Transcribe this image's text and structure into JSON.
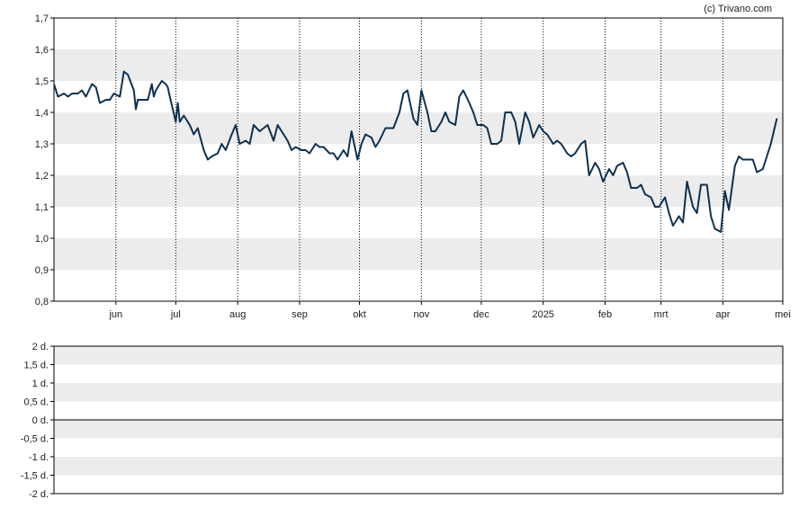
{
  "copyright": "(c) Trivano.com",
  "colors": {
    "line": "#0d3150",
    "band": "#ececec",
    "axis": "#000000",
    "grid_dotted": "#000000"
  },
  "chart_data": [
    {
      "type": "line",
      "title": "",
      "xlabel": "",
      "ylabel": "",
      "ylim": [
        0.8,
        1.7
      ],
      "y_ticks": [
        "1,7",
        "1,6",
        "1,5",
        "1,4",
        "1,3",
        "1,2",
        "1,1",
        "1,0",
        "0,9",
        "0,8"
      ],
      "y_tick_values": [
        1.7,
        1.6,
        1.5,
        1.4,
        1.3,
        1.2,
        1.1,
        1.0,
        0.9,
        0.8
      ],
      "x_range": [
        "2024-05-01",
        "2025-05-01"
      ],
      "x_ticks": [
        {
          "label": "jun",
          "date": "2024-06-01"
        },
        {
          "label": "jul",
          "date": "2024-07-01"
        },
        {
          "label": "aug",
          "date": "2024-08-01"
        },
        {
          "label": "sep",
          "date": "2024-09-01"
        },
        {
          "label": "okt",
          "date": "2024-10-01"
        },
        {
          "label": "nov",
          "date": "2024-11-01"
        },
        {
          "label": "dec",
          "date": "2024-12-01"
        },
        {
          "label": "2025",
          "date": "2025-01-01"
        },
        {
          "label": "feb",
          "date": "2025-02-01"
        },
        {
          "label": "mrt",
          "date": "2025-03-01"
        },
        {
          "label": "apr",
          "date": "2025-04-01"
        },
        {
          "label": "mei",
          "date": "2025-05-01"
        }
      ],
      "grid": "alternating horizontal bands, dotted vertical month lines",
      "series": [
        {
          "points": [
            [
              "2024-05-01",
              1.49
            ],
            [
              "2024-05-03",
              1.45
            ],
            [
              "2024-05-06",
              1.46
            ],
            [
              "2024-05-08",
              1.45
            ],
            [
              "2024-05-10",
              1.46
            ],
            [
              "2024-05-13",
              1.46
            ],
            [
              "2024-05-15",
              1.47
            ],
            [
              "2024-05-17",
              1.45
            ],
            [
              "2024-05-20",
              1.49
            ],
            [
              "2024-05-22",
              1.48
            ],
            [
              "2024-05-24",
              1.43
            ],
            [
              "2024-05-27",
              1.44
            ],
            [
              "2024-05-29",
              1.44
            ],
            [
              "2024-05-31",
              1.46
            ],
            [
              "2024-06-03",
              1.45
            ],
            [
              "2024-06-05",
              1.53
            ],
            [
              "2024-06-07",
              1.52
            ],
            [
              "2024-06-10",
              1.47
            ],
            [
              "2024-06-11",
              1.41
            ],
            [
              "2024-06-12",
              1.44
            ],
            [
              "2024-06-14",
              1.44
            ],
            [
              "2024-06-17",
              1.44
            ],
            [
              "2024-06-19",
              1.49
            ],
            [
              "2024-06-20",
              1.45
            ],
            [
              "2024-06-21",
              1.47
            ],
            [
              "2024-06-24",
              1.5
            ],
            [
              "2024-06-26",
              1.49
            ],
            [
              "2024-06-27",
              1.48
            ],
            [
              "2024-06-28",
              1.45
            ],
            [
              "2024-07-01",
              1.37
            ],
            [
              "2024-07-02",
              1.43
            ],
            [
              "2024-07-03",
              1.37
            ],
            [
              "2024-07-05",
              1.39
            ],
            [
              "2024-07-08",
              1.36
            ],
            [
              "2024-07-10",
              1.33
            ],
            [
              "2024-07-12",
              1.35
            ],
            [
              "2024-07-15",
              1.28
            ],
            [
              "2024-07-17",
              1.25
            ],
            [
              "2024-07-19",
              1.26
            ],
            [
              "2024-07-22",
              1.27
            ],
            [
              "2024-07-24",
              1.3
            ],
            [
              "2024-07-26",
              1.28
            ],
            [
              "2024-07-29",
              1.33
            ],
            [
              "2024-07-31",
              1.36
            ],
            [
              "2024-08-02",
              1.3
            ],
            [
              "2024-08-05",
              1.31
            ],
            [
              "2024-08-07",
              1.3
            ],
            [
              "2024-08-09",
              1.36
            ],
            [
              "2024-08-12",
              1.34
            ],
            [
              "2024-08-14",
              1.35
            ],
            [
              "2024-08-16",
              1.36
            ],
            [
              "2024-08-19",
              1.31
            ],
            [
              "2024-08-21",
              1.36
            ],
            [
              "2024-08-23",
              1.34
            ],
            [
              "2024-08-26",
              1.31
            ],
            [
              "2024-08-28",
              1.28
            ],
            [
              "2024-08-30",
              1.29
            ],
            [
              "2024-09-02",
              1.28
            ],
            [
              "2024-09-04",
              1.28
            ],
            [
              "2024-09-06",
              1.27
            ],
            [
              "2024-09-09",
              1.3
            ],
            [
              "2024-09-11",
              1.29
            ],
            [
              "2024-09-13",
              1.29
            ],
            [
              "2024-09-16",
              1.27
            ],
            [
              "2024-09-18",
              1.27
            ],
            [
              "2024-09-20",
              1.25
            ],
            [
              "2024-09-23",
              1.28
            ],
            [
              "2024-09-25",
              1.26
            ],
            [
              "2024-09-27",
              1.34
            ],
            [
              "2024-09-30",
              1.25
            ],
            [
              "2024-10-02",
              1.3
            ],
            [
              "2024-10-04",
              1.33
            ],
            [
              "2024-10-07",
              1.32
            ],
            [
              "2024-10-09",
              1.29
            ],
            [
              "2024-10-11",
              1.31
            ],
            [
              "2024-10-14",
              1.35
            ],
            [
              "2024-10-16",
              1.35
            ],
            [
              "2024-10-18",
              1.35
            ],
            [
              "2024-10-21",
              1.4
            ],
            [
              "2024-10-23",
              1.46
            ],
            [
              "2024-10-25",
              1.47
            ],
            [
              "2024-10-28",
              1.38
            ],
            [
              "2024-10-30",
              1.36
            ],
            [
              "2024-11-01",
              1.47
            ],
            [
              "2024-11-04",
              1.4
            ],
            [
              "2024-11-06",
              1.34
            ],
            [
              "2024-11-08",
              1.34
            ],
            [
              "2024-11-11",
              1.37
            ],
            [
              "2024-11-13",
              1.4
            ],
            [
              "2024-11-15",
              1.37
            ],
            [
              "2024-11-18",
              1.36
            ],
            [
              "2024-11-20",
              1.45
            ],
            [
              "2024-11-22",
              1.47
            ],
            [
              "2024-11-25",
              1.43
            ],
            [
              "2024-11-27",
              1.4
            ],
            [
              "2024-11-29",
              1.36
            ],
            [
              "2024-12-02",
              1.36
            ],
            [
              "2024-12-04",
              1.35
            ],
            [
              "2024-12-06",
              1.3
            ],
            [
              "2024-12-09",
              1.3
            ],
            [
              "2024-12-11",
              1.31
            ],
            [
              "2024-12-13",
              1.4
            ],
            [
              "2024-12-16",
              1.4
            ],
            [
              "2024-12-18",
              1.37
            ],
            [
              "2024-12-20",
              1.3
            ],
            [
              "2024-12-23",
              1.4
            ],
            [
              "2024-12-25",
              1.37
            ],
            [
              "2024-12-27",
              1.32
            ],
            [
              "2024-12-30",
              1.36
            ],
            [
              "2025-01-01",
              1.34
            ],
            [
              "2025-01-03",
              1.33
            ],
            [
              "2025-01-06",
              1.3
            ],
            [
              "2025-01-08",
              1.31
            ],
            [
              "2025-01-10",
              1.3
            ],
            [
              "2025-01-13",
              1.27
            ],
            [
              "2025-01-15",
              1.26
            ],
            [
              "2025-01-17",
              1.27
            ],
            [
              "2025-01-20",
              1.3
            ],
            [
              "2025-01-22",
              1.31
            ],
            [
              "2025-01-24",
              1.2
            ],
            [
              "2025-01-27",
              1.24
            ],
            [
              "2025-01-29",
              1.22
            ],
            [
              "2025-01-31",
              1.18
            ],
            [
              "2025-02-03",
              1.22
            ],
            [
              "2025-02-05",
              1.2
            ],
            [
              "2025-02-07",
              1.23
            ],
            [
              "2025-02-10",
              1.24
            ],
            [
              "2025-02-12",
              1.21
            ],
            [
              "2025-02-14",
              1.16
            ],
            [
              "2025-02-17",
              1.16
            ],
            [
              "2025-02-19",
              1.17
            ],
            [
              "2025-02-21",
              1.14
            ],
            [
              "2025-02-24",
              1.13
            ],
            [
              "2025-02-26",
              1.1
            ],
            [
              "2025-02-28",
              1.1
            ],
            [
              "2025-03-03",
              1.13
            ],
            [
              "2025-03-05",
              1.08
            ],
            [
              "2025-03-07",
              1.04
            ],
            [
              "2025-03-10",
              1.07
            ],
            [
              "2025-03-12",
              1.05
            ],
            [
              "2025-03-14",
              1.18
            ],
            [
              "2025-03-17",
              1.1
            ],
            [
              "2025-03-19",
              1.08
            ],
            [
              "2025-03-21",
              1.17
            ],
            [
              "2025-03-24",
              1.17
            ],
            [
              "2025-03-26",
              1.07
            ],
            [
              "2025-03-28",
              1.03
            ],
            [
              "2025-03-31",
              1.02
            ],
            [
              "2025-04-02",
              1.15
            ],
            [
              "2025-04-04",
              1.09
            ],
            [
              "2025-04-07",
              1.23
            ],
            [
              "2025-04-09",
              1.26
            ],
            [
              "2025-04-11",
              1.25
            ],
            [
              "2025-04-14",
              1.25
            ],
            [
              "2025-04-16",
              1.25
            ],
            [
              "2025-04-18",
              1.21
            ],
            [
              "2025-04-21",
              1.22
            ],
            [
              "2025-04-23",
              1.26
            ],
            [
              "2025-04-25",
              1.3
            ],
            [
              "2025-04-28",
              1.38
            ]
          ]
        }
      ]
    },
    {
      "type": "bar",
      "title": "",
      "xlabel": "",
      "ylabel": "",
      "ylim": [
        -2,
        2
      ],
      "y_ticks": [
        "2 d.",
        "1,5 d.",
        "1 d.",
        "0,5 d.",
        "0 d.",
        "-0,5 d.",
        "-1 d.",
        "-1,5 d.",
        "-2 d."
      ],
      "y_tick_values": [
        2,
        1.5,
        1,
        0.5,
        0,
        -0.5,
        -1,
        -1.5,
        -2
      ],
      "grid": "alternating horizontal bands",
      "series": []
    }
  ]
}
